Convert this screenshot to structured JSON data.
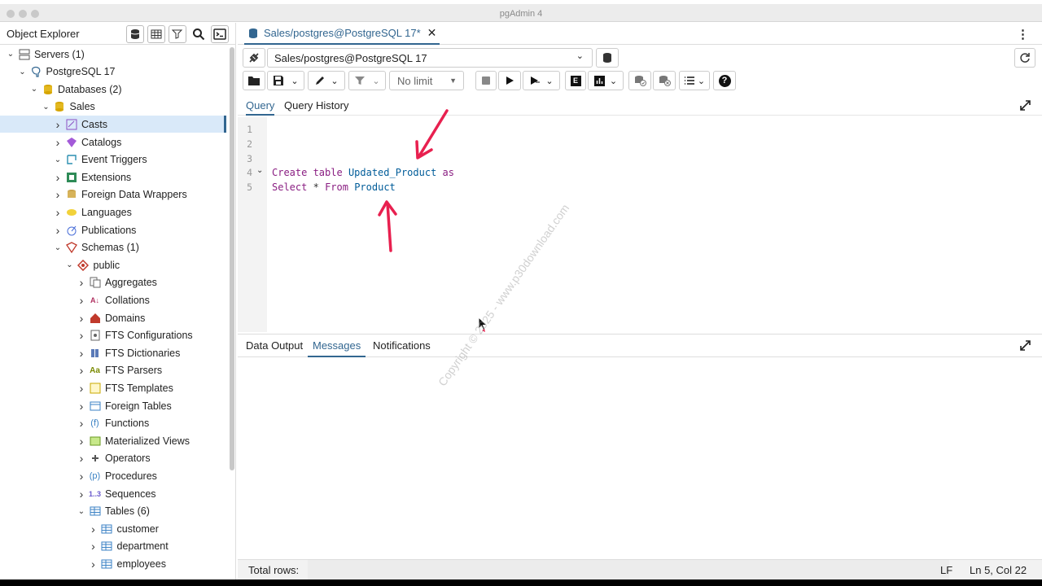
{
  "window": {
    "title": "pgAdmin 4"
  },
  "object_explorer": {
    "title": "Object Explorer",
    "tree": [
      {
        "label": "Servers (1)",
        "depth": 0,
        "expanded": true,
        "icon": "servers-icon"
      },
      {
        "label": "PostgreSQL 17",
        "depth": 1,
        "expanded": true,
        "icon": "elephant-icon"
      },
      {
        "label": "Databases (2)",
        "depth": 2,
        "expanded": true,
        "icon": "databases-icon"
      },
      {
        "label": "Sales",
        "depth": 3,
        "expanded": true,
        "icon": "database-icon"
      },
      {
        "label": "Casts",
        "depth": 4,
        "expanded": false,
        "icon": "casts-icon",
        "selected": true
      },
      {
        "label": "Catalogs",
        "depth": 4,
        "expanded": false,
        "icon": "catalogs-icon"
      },
      {
        "label": "Event Triggers",
        "depth": 4,
        "expanded": true,
        "icon": "event-triggers-icon"
      },
      {
        "label": "Extensions",
        "depth": 4,
        "expanded": false,
        "icon": "extensions-icon"
      },
      {
        "label": "Foreign Data Wrappers",
        "depth": 4,
        "expanded": false,
        "icon": "fdw-icon"
      },
      {
        "label": "Languages",
        "depth": 4,
        "expanded": false,
        "icon": "languages-icon"
      },
      {
        "label": "Publications",
        "depth": 4,
        "expanded": false,
        "icon": "publications-icon"
      },
      {
        "label": "Schemas (1)",
        "depth": 4,
        "expanded": true,
        "icon": "schemas-icon"
      },
      {
        "label": "public",
        "depth": 5,
        "expanded": true,
        "icon": "schema-icon"
      },
      {
        "label": "Aggregates",
        "depth": 6,
        "expanded": false,
        "icon": "aggregates-icon"
      },
      {
        "label": "Collations",
        "depth": 6,
        "expanded": false,
        "icon": "collations-icon"
      },
      {
        "label": "Domains",
        "depth": 6,
        "expanded": false,
        "icon": "domains-icon"
      },
      {
        "label": "FTS Configurations",
        "depth": 6,
        "expanded": false,
        "icon": "fts-config-icon"
      },
      {
        "label": "FTS Dictionaries",
        "depth": 6,
        "expanded": false,
        "icon": "fts-dict-icon"
      },
      {
        "label": "FTS Parsers",
        "depth": 6,
        "expanded": false,
        "icon": "fts-parsers-icon"
      },
      {
        "label": "FTS Templates",
        "depth": 6,
        "expanded": false,
        "icon": "fts-templates-icon"
      },
      {
        "label": "Foreign Tables",
        "depth": 6,
        "expanded": false,
        "icon": "foreign-tables-icon"
      },
      {
        "label": "Functions",
        "depth": 6,
        "expanded": false,
        "icon": "functions-icon"
      },
      {
        "label": "Materialized Views",
        "depth": 6,
        "expanded": false,
        "icon": "mviews-icon"
      },
      {
        "label": "Operators",
        "depth": 6,
        "expanded": false,
        "icon": "operators-icon"
      },
      {
        "label": "Procedures",
        "depth": 6,
        "expanded": false,
        "icon": "procedures-icon"
      },
      {
        "label": "Sequences",
        "depth": 6,
        "expanded": false,
        "icon": "sequences-icon"
      },
      {
        "label": "Tables (6)",
        "depth": 6,
        "expanded": true,
        "icon": "tables-icon"
      },
      {
        "label": "customer",
        "depth": 7,
        "expanded": false,
        "icon": "table-icon"
      },
      {
        "label": "department",
        "depth": 7,
        "expanded": false,
        "icon": "table-icon"
      },
      {
        "label": "employees",
        "depth": 7,
        "expanded": false,
        "icon": "table-icon"
      }
    ]
  },
  "query_tab": {
    "label": "Sales/postgres@PostgreSQL 17*"
  },
  "connection": {
    "value": "Sales/postgres@PostgreSQL 17"
  },
  "toolbar": {
    "limit": "No limit"
  },
  "subtabs": {
    "query": "Query",
    "history": "Query History"
  },
  "editor": {
    "line_numbers": [
      "1",
      "2",
      "3",
      "4",
      "5"
    ],
    "line4": {
      "kw1": "Create table",
      "ident": "Updated_Product",
      "kw2": "as"
    },
    "line5": {
      "kw1": "Select",
      "op": "*",
      "kw2": "From",
      "ident": "Product"
    }
  },
  "results": {
    "data_output": "Data Output",
    "messages": "Messages",
    "notifications": "Notifications"
  },
  "status": {
    "total_rows": "Total rows:",
    "eol": "LF",
    "position": "Ln 5, Col 22"
  },
  "watermark": {
    "text": "Copyright © 2025 - www.p30download.com"
  },
  "colors": {
    "accent": "#326690",
    "keyword": "#8a1e82",
    "identifier": "#005c99",
    "arrow": "#e8204f"
  }
}
